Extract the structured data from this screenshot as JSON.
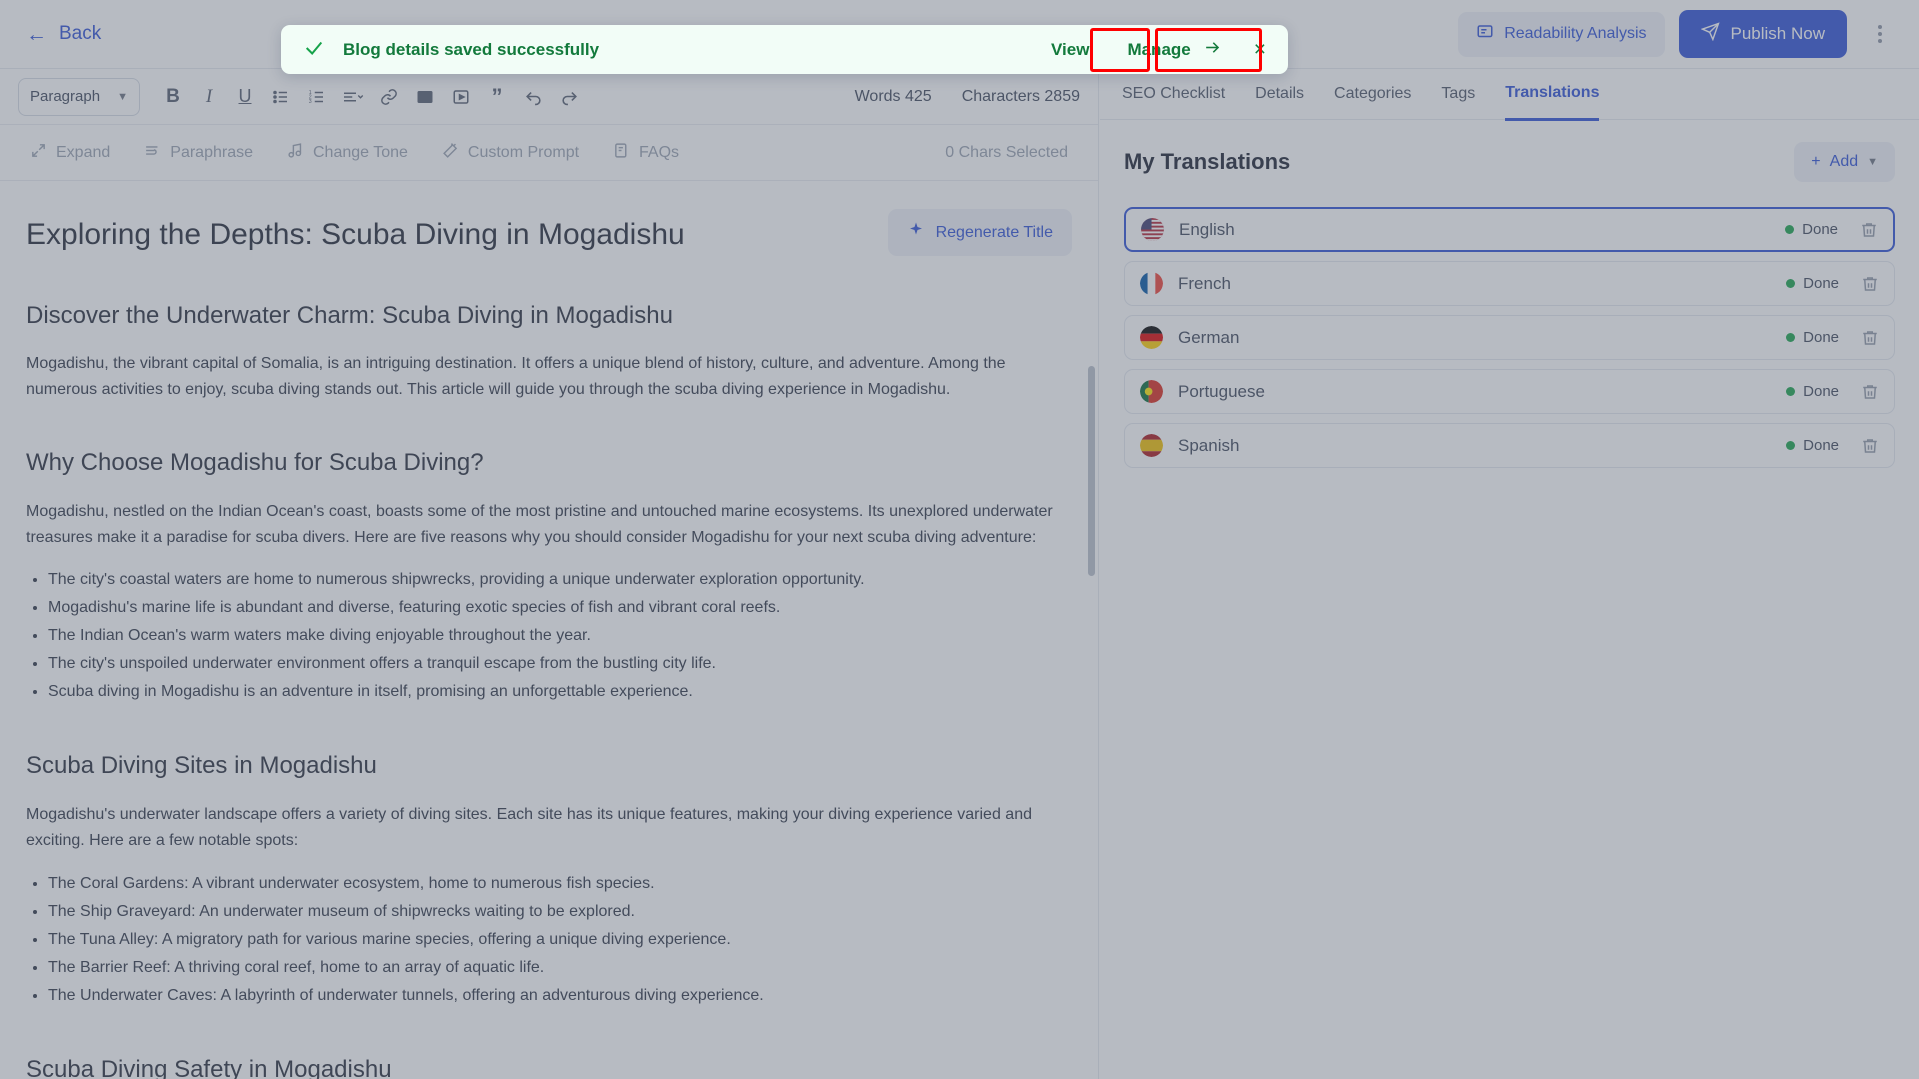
{
  "topbar": {
    "back_label": "Back",
    "readability_label": "Readability Analysis",
    "publish_label": "Publish Now",
    "more_icon": "kebab-menu-icon"
  },
  "toast": {
    "message": "Blog details saved successfully",
    "view_label": "View",
    "manage_label": "Manage",
    "close_icon": "close-icon",
    "check_icon": "check-icon",
    "bg_color": "#f2fdf7",
    "text_color": "#137a3c",
    "highlight_color": "#ff0000"
  },
  "toolbar": {
    "block_format": "Paragraph",
    "icons": [
      "bold-icon",
      "italic-icon",
      "underline-icon",
      "bullet-list-icon",
      "numbered-list-icon",
      "align-icon",
      "link-icon",
      "image-icon",
      "video-icon",
      "quote-icon",
      "undo-icon",
      "redo-icon"
    ],
    "words_label": "Words",
    "words_value": "425",
    "characters_label": "Characters",
    "characters_value": "2859"
  },
  "ai_toolbar": {
    "items": [
      {
        "label": "Expand",
        "icon": "expand-icon"
      },
      {
        "label": "Paraphrase",
        "icon": "paraphrase-icon"
      },
      {
        "label": "Change Tone",
        "icon": "tone-icon"
      },
      {
        "label": "Custom Prompt",
        "icon": "magic-wand-icon"
      },
      {
        "label": "FAQs",
        "icon": "faq-icon"
      }
    ],
    "chars_selected": "0 Chars Selected"
  },
  "document": {
    "title": "Exploring the Depths: Scuba Diving in Mogadishu",
    "regenerate_label": "Regenerate Title",
    "sections": [
      {
        "heading": "Discover the Underwater Charm: Scuba Diving in Mogadishu",
        "paragraphs": [
          "Mogadishu, the vibrant capital of Somalia, is an intriguing destination. It offers a unique blend of history, culture, and adventure. Among the numerous activities to enjoy, scuba diving stands out. This article will guide you through the scuba diving experience in Mogadishu."
        ],
        "list": []
      },
      {
        "heading": "Why Choose Mogadishu for Scuba Diving?",
        "paragraphs": [
          "Mogadishu, nestled on the Indian Ocean's coast, boasts some of the most pristine and untouched marine ecosystems. Its unexplored underwater treasures make it a paradise for scuba divers. Here are five reasons why you should consider Mogadishu for your next scuba diving adventure:"
        ],
        "list": [
          "The city's coastal waters are home to numerous shipwrecks, providing a unique underwater exploration opportunity.",
          "Mogadishu's marine life is abundant and diverse, featuring exotic species of fish and vibrant coral reefs.",
          "The Indian Ocean's warm waters make diving enjoyable throughout the year.",
          "The city's unspoiled underwater environment offers a tranquil escape from the bustling city life.",
          "Scuba diving in Mogadishu is an adventure in itself, promising an unforgettable experience."
        ]
      },
      {
        "heading": "Scuba Diving Sites in Mogadishu",
        "paragraphs": [
          "Mogadishu's underwater landscape offers a variety of diving sites. Each site has its unique features, making your diving experience varied and exciting. Here are a few notable spots:"
        ],
        "list": [
          "The Coral Gardens: A vibrant underwater ecosystem, home to numerous fish species.",
          "The Ship Graveyard: An underwater museum of shipwrecks waiting to be explored.",
          "The Tuna Alley: A migratory path for various marine species, offering a unique diving experience.",
          "The Barrier Reef: A thriving coral reef, home to an array of aquatic life.",
          "The Underwater Caves: A labyrinth of underwater tunnels, offering an adventurous diving experience."
        ]
      },
      {
        "heading": "Scuba Diving Safety in Mogadishu",
        "paragraphs": [],
        "list": []
      }
    ]
  },
  "sidebar": {
    "tabs": [
      {
        "label": "SEO Checklist",
        "active": false
      },
      {
        "label": "Details",
        "active": false
      },
      {
        "label": "Categories",
        "active": false
      },
      {
        "label": "Tags",
        "active": false
      },
      {
        "label": "Translations",
        "active": true
      }
    ],
    "panel_title": "My Translations",
    "add_label": "Add",
    "add_icon": "plus-icon",
    "add_chevron_icon": "chevron-down-icon",
    "translations": [
      {
        "language": "English",
        "status": "Done",
        "selected": true,
        "flag": "flag-us",
        "delete_icon": "trash-icon"
      },
      {
        "language": "French",
        "status": "Done",
        "selected": false,
        "flag": "flag-fr",
        "delete_icon": "trash-icon"
      },
      {
        "language": "German",
        "status": "Done",
        "selected": false,
        "flag": "flag-de",
        "delete_icon": "trash-icon"
      },
      {
        "language": "Portuguese",
        "status": "Done",
        "selected": false,
        "flag": "flag-pt",
        "delete_icon": "trash-icon"
      },
      {
        "language": "Spanish",
        "status": "Done",
        "selected": false,
        "flag": "flag-es",
        "delete_icon": "trash-icon"
      }
    ],
    "status_color": "#16a34a"
  }
}
